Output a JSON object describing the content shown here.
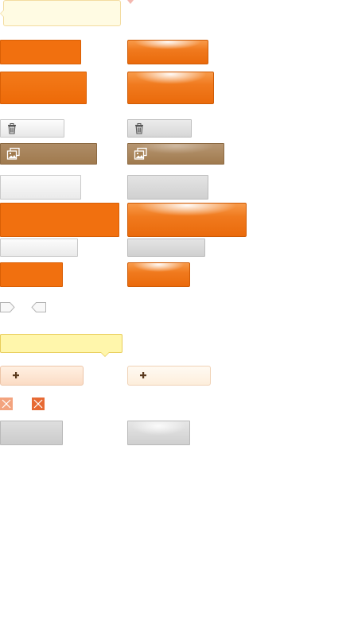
{
  "palette": {
    "orange": "#f1700f",
    "orange_border": "#d95f05",
    "brown": "#a07a4e",
    "grey": "#e8e8e8",
    "tooltip_yellow": "#fff6ab",
    "tooltip_cream": "#fffbe3",
    "add_peach": "#fbdcc5",
    "close_orange": "#f08a5c"
  },
  "icons": {
    "trash": "trash-icon",
    "images": "images-icon",
    "plus": "plus-icon",
    "close": "close-icon",
    "arrow_right_tag": "arrow-right-tag-icon",
    "arrow_left_tag": "arrow-left-tag-icon"
  }
}
